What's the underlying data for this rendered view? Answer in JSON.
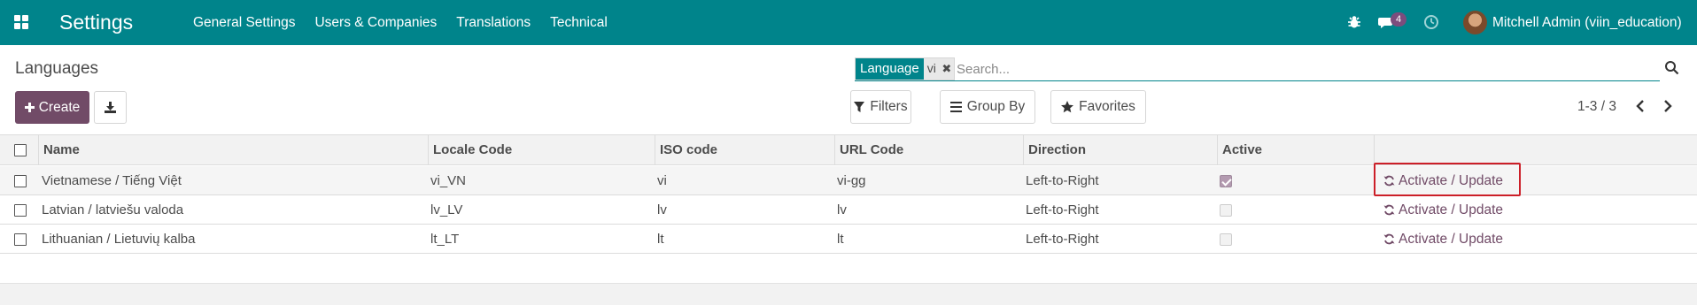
{
  "navbar": {
    "app_title": "Settings",
    "menu": [
      "General Settings",
      "Users & Companies",
      "Translations",
      "Technical"
    ],
    "chat_badge": "4",
    "user_name": "Mitchell Admin (viin_education)",
    "color": "#00848b"
  },
  "control_panel": {
    "title": "Languages",
    "create_label": "Create",
    "search": {
      "facet_label": "Language",
      "facet_value": "vi",
      "placeholder": "Search..."
    },
    "filters_label": "Filters",
    "groupby_label": "Group By",
    "favorites_label": "Favorites",
    "pager": "1-3 / 3"
  },
  "table": {
    "columns": [
      "Name",
      "Locale Code",
      "ISO code",
      "URL Code",
      "Direction",
      "Active"
    ],
    "rows": [
      {
        "name": "Vietnamese / Tiếng Việt",
        "locale": "vi_VN",
        "iso": "vi",
        "url": "vi-gg",
        "direction": "Left-to-Right",
        "active": true,
        "action": "Activate / Update"
      },
      {
        "name": "Latvian / latviešu valoda",
        "locale": "lv_LV",
        "iso": "lv",
        "url": "lv",
        "direction": "Left-to-Right",
        "active": false,
        "action": "Activate / Update"
      },
      {
        "name": "Lithuanian / Lietuvių kalba",
        "locale": "lt_LT",
        "iso": "lt",
        "url": "lt",
        "direction": "Left-to-Right",
        "active": false,
        "action": "Activate / Update"
      }
    ]
  },
  "colors": {
    "primary": "#714b67",
    "accent": "#00848b",
    "highlight": "#cc1f28"
  }
}
